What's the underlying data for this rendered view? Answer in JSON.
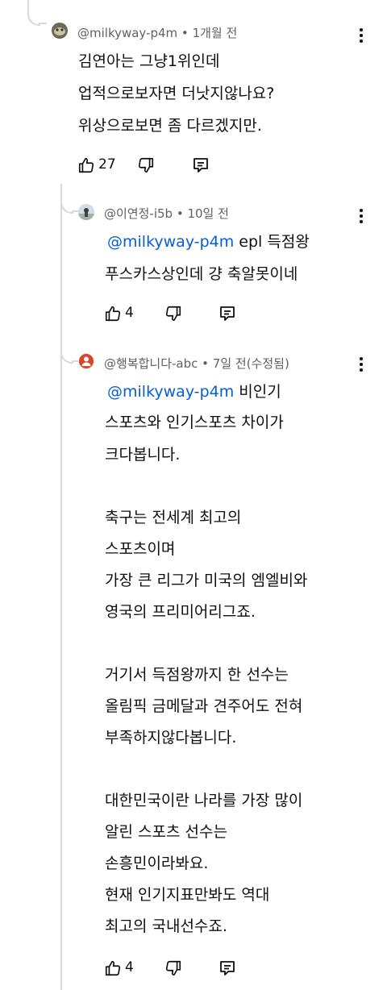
{
  "comments": [
    {
      "author": "@milkyway-p4m",
      "time": "1개월 전",
      "lines": [
        "김연아는 그냥1위인데",
        "업적으로보자면 더낫지않나요?",
        "위상으로보면 좀 다르겠지만."
      ],
      "likes": "27"
    },
    {
      "author": "@이연정-i5b",
      "time": "10일 전",
      "mention": "@milkyway-p4m",
      "first_line_rest": "epl 득점왕",
      "lines": [
        "푸스카스상인데 걍 축알못이네"
      ],
      "likes": "4"
    },
    {
      "author": "@행복합니다-abc",
      "time": "7일 전(수정됨)",
      "mention": "@milkyway-p4m",
      "first_line_rest": "비인기",
      "lines": [
        "스포츠와 인기스포츠 차이가",
        "크다봅니다.",
        "축구는 전세계 최고의",
        "스포츠이며",
        "가장 큰 리그가 미국의 엠엘비와",
        "영국의 프리미어리그죠.",
        "거기서 득점왕까지 한 선수는",
        "올림픽 금메달과 견주어도 전혀",
        "부족하지않다봅니다.",
        "대한민국이란 나라를 가장 많이",
        "알린 스포츠 선수는",
        "손흥민이라봐요.",
        "현재 인기지표만봐도 역대",
        "최고의 국내선수죠."
      ],
      "likes": "4"
    }
  ],
  "separator": "•",
  "colors": {
    "mention": "#065fd4",
    "meta": "#606060",
    "text": "#0f0f0f",
    "thread": "#d9d9d9"
  }
}
